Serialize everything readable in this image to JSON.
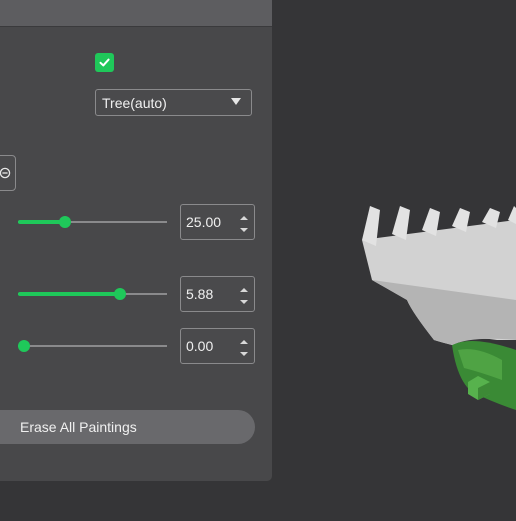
{
  "support": {
    "enabled": true,
    "type_select": {
      "value": "Tree(auto)"
    }
  },
  "sliders": [
    {
      "name": "threshold-angle",
      "value_text": "25.00",
      "fraction": 0.3
    },
    {
      "name": "brush-size",
      "value_text": "5.88",
      "fraction": 0.7
    },
    {
      "name": "brush-height",
      "value_text": "0.00",
      "fraction": 0.0
    }
  ],
  "buttons": {
    "erase_all": "Erase All Paintings"
  },
  "icons": {
    "checkbox": "check-icon",
    "dropdown": "caret-down-icon",
    "partial_button": "circle-minus-icon",
    "spin_up": "spin-up-icon",
    "spin_down": "spin-down-icon"
  },
  "colors": {
    "accent": "#1fc85a",
    "panel": "#48484a",
    "viewport": "#353537",
    "model": "#d2d2d2",
    "painted_support": "#3a8a35"
  }
}
